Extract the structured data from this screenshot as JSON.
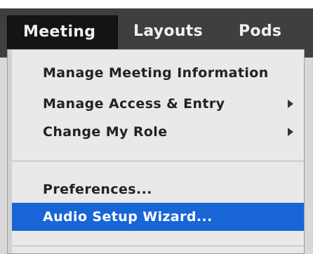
{
  "menubar": {
    "tabs": [
      {
        "label": "Meeting",
        "active": true
      },
      {
        "label": "Layouts",
        "active": false
      },
      {
        "label": "Pods",
        "active": false
      }
    ]
  },
  "dropdown": {
    "items": [
      {
        "label": "Manage Meeting Information",
        "has_submenu": false
      },
      {
        "label": "Manage Access & Entry",
        "has_submenu": true
      },
      {
        "label": "Change My Role",
        "has_submenu": true
      },
      {
        "label": "Preferences...",
        "has_submenu": false
      },
      {
        "label": "Audio Setup Wizard...",
        "has_submenu": false,
        "highlighted": true
      }
    ]
  },
  "colors": {
    "menubar_bg": "#3f3f3f",
    "active_tab_bg": "#141414",
    "dropdown_bg": "#e9e9e9",
    "highlight_bg": "#1866d6",
    "highlight_text": "#ffffff"
  }
}
